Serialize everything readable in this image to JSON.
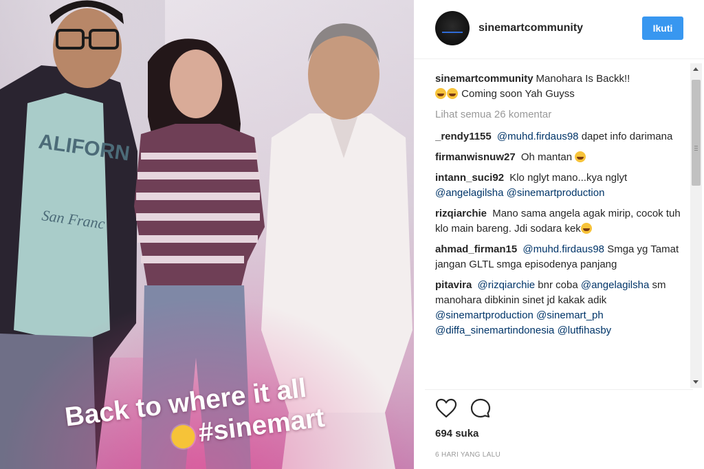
{
  "post": {
    "photo_caption_line1": "Back to where it all",
    "photo_caption_line2": "#sinemart"
  },
  "header": {
    "username": "sinemartcommunity",
    "follow_label": "Ikuti"
  },
  "caption": {
    "user": "sinemartcommunity",
    "text": "Manohara Is Backk!!",
    "text_after": "Coming soon Yah Guyss"
  },
  "view_all": "Lihat semua 26 komentar",
  "comments": [
    {
      "user": "_rendy1155",
      "mention1": "@muhd.firdaus98",
      "text": "dapet info darimana"
    },
    {
      "user": "firmanwisnuw27",
      "text": "Oh mantan"
    },
    {
      "user": "intann_suci92",
      "text": "Klo nglyt mano...kya nglyt",
      "mention1": "@angelagilsha",
      "mention2": "@sinemartproduction"
    },
    {
      "user": "rizqiarchie",
      "text": "Mano sama angela agak mirip, cocok tuh klo main bareng. Jdi sodara kek"
    },
    {
      "user": "ahmad_firman15",
      "mention1": "@muhd.firdaus98",
      "text": "Smga yg Tamat jangan GLTL smga episodenya panjang"
    },
    {
      "user": "pitavira",
      "mention1": "@rizqiarchie",
      "text1": "bnr coba",
      "mention2": "@angelagilsha",
      "text2": "sm manohara dibkinin sinet jd kakak adik",
      "mention3": "@sinemartproduction",
      "mention4": "@sinemart_ph",
      "mention5": "@diffa_sinemartindonesia",
      "mention6": "@lutfihasby"
    }
  ],
  "likes": "694 suka",
  "time": "6 HARI YANG LALU",
  "icons": {
    "like": "heart-icon",
    "comment": "comment-bubble-icon"
  },
  "colors": {
    "follow_button": "#3897f0",
    "mention": "#003569",
    "muted": "#999999"
  }
}
